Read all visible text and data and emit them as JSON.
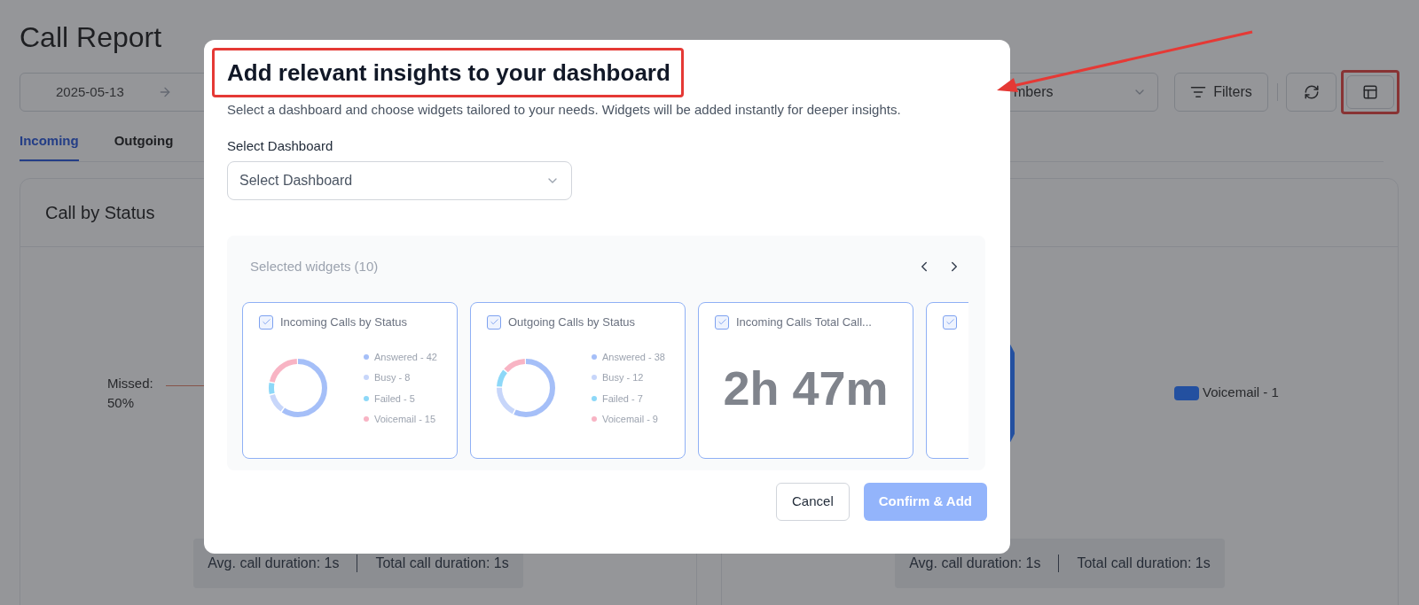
{
  "page": {
    "title": "Call Report",
    "date_start": "2025-05-13",
    "members_select": "mbers",
    "filters_button": "Filters",
    "tabs": [
      {
        "label": "Incoming",
        "selected": true
      },
      {
        "label": "Outgoing",
        "selected": false
      }
    ],
    "cards": [
      {
        "kind": "pie-label",
        "title": "Call by Status",
        "chart_label": "Missed: 50%",
        "stats": [
          "Avg. call duration: 1s",
          "Total call duration: 1s"
        ]
      },
      {
        "kind": "pie-legend",
        "legend": [
          {
            "label": "Voicemail - 1",
            "color": "#2350a0"
          }
        ],
        "stats": [
          "Avg. call duration: 1s",
          "Total call duration: 1s"
        ]
      }
    ]
  },
  "modal": {
    "title": "Add relevant insights to your dashboard",
    "subtitle": "Select a dashboard and choose widgets tailored to your needs. Widgets will be added instantly for deeper insights.",
    "select_label": "Select Dashboard",
    "select_placeholder": "Select Dashboard",
    "widgets_heading": "Selected widgets (10)",
    "widgets": [
      {
        "kind": "donut",
        "title": "Incoming Calls by Status",
        "checked": true,
        "legend": [
          {
            "label": "Answered - 42",
            "color": "#a5bff8"
          },
          {
            "label": "Busy - 8",
            "color": "#c7d6fa"
          },
          {
            "label": "Failed - 5",
            "color": "#8dd8f8"
          },
          {
            "label": "Voicemail - 15",
            "color": "#f8b4c4"
          }
        ]
      },
      {
        "kind": "donut",
        "title": "Outgoing Calls by Status",
        "checked": true,
        "legend": [
          {
            "label": "Answered - 38",
            "color": "#a5bff8"
          },
          {
            "label": "Busy - 12",
            "color": "#c7d6fa"
          },
          {
            "label": "Failed - 7",
            "color": "#8dd8f8"
          },
          {
            "label": "Voicemail - 9",
            "color": "#f8b4c4"
          }
        ]
      },
      {
        "kind": "value",
        "title": "Incoming Calls Total Call...",
        "checked": true,
        "value": "2h 47m"
      },
      {
        "kind": "value",
        "checked": true
      }
    ],
    "buttons": [
      {
        "kind": "secondary",
        "label": "Cancel",
        "disabled": false
      },
      {
        "kind": "primary",
        "label": "Confirm & Add",
        "disabled": true
      }
    ]
  }
}
